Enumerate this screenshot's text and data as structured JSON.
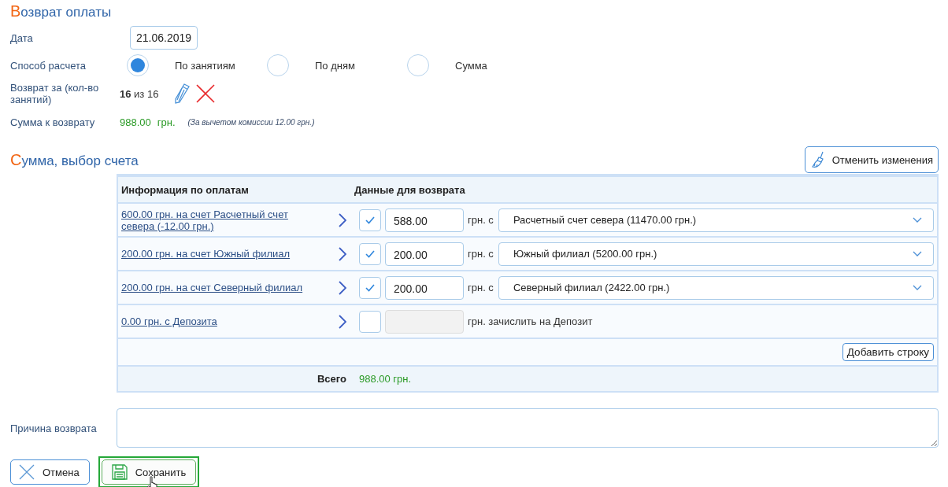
{
  "refund": {
    "title": "Возврат оплаты",
    "date": {
      "label": "Дата",
      "value": "21.06.2019"
    },
    "method": {
      "label": "Способ расчета",
      "options": [
        {
          "label": "По занятиям",
          "selected": true
        },
        {
          "label": "По дням",
          "selected": false
        },
        {
          "label": "Сумма",
          "selected": false
        }
      ]
    },
    "count": {
      "label": "Возврат за (кол-во занятий)",
      "value": "**16** из 16"
    },
    "amount": {
      "label": "Сумма к возврату",
      "value": "988.00",
      "currency": "грн.",
      "note": "(За вычетом комиссии 12.00 грн.)"
    }
  },
  "accounts": {
    "title": "Сумма, выбор счета",
    "reset_button": "Отменить изменения",
    "columns": [
      "Информация по оплатам",
      "Данные для возврата"
    ],
    "rows": [
      {
        "kind": "account",
        "payment": "600.00 грн. на счет Расчетный счет севера (-12.00 грн.)",
        "checked": true,
        "amount": "588.00",
        "unit": "грн. с",
        "account": "Расчетный счет севера (11470.00 грн.)"
      },
      {
        "kind": "account",
        "payment": "200.00 грн. на счет Южный филиал",
        "checked": true,
        "amount": "200.00",
        "unit": "грн. с",
        "account": "Южный филиал (5200.00 грн.)"
      },
      {
        "kind": "account",
        "payment": "200.00 грн. на счет Северный филиал",
        "checked": true,
        "amount": "200.00",
        "unit": "грн. с",
        "account": "Северный филиал (2422.00 грн.)"
      },
      {
        "kind": "deposit",
        "payment": "0.00 грн. с Депозита",
        "checked": false,
        "unit": "грн. зачислить на Депозит"
      }
    ],
    "add_button": "Добавить строку",
    "total": {
      "label": "Всего",
      "value": "988.00 грн."
    }
  },
  "reason": {
    "label": "Причина возврата"
  },
  "buttons": [
    {
      "kind": "cancel",
      "label": "Отмена",
      "focused": false
    },
    {
      "kind": "save",
      "label": "Сохранить",
      "focused": true
    }
  ]
}
